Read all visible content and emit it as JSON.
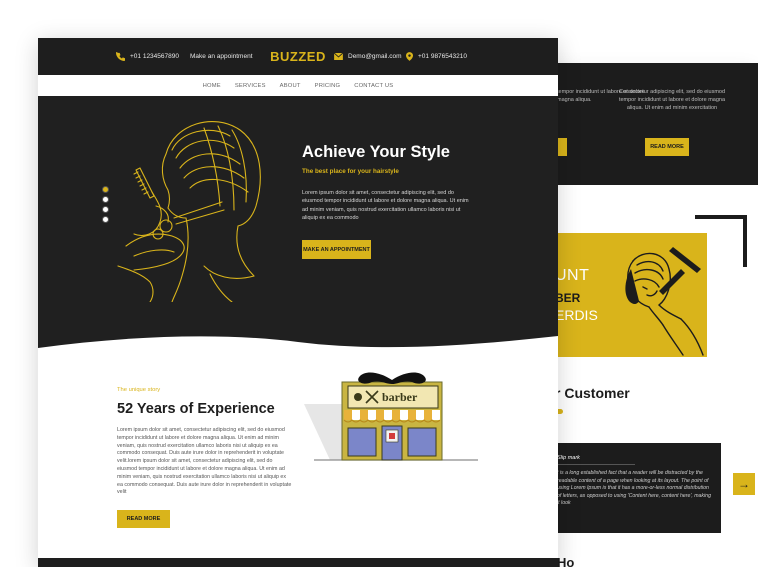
{
  "topbar": {
    "phone_left": "+01 1234567890",
    "appointment": "Make an appointment",
    "brand": "BUZZED",
    "email": "Demo@gmail.com",
    "phone_right": "+01 9876543210"
  },
  "nav": {
    "items": [
      "HOME",
      "SERVICES",
      "ABOUT",
      "PRICING",
      "CONTACT US"
    ]
  },
  "hero": {
    "title": "Achieve Your Style",
    "subtitle": "The best place for your hairstyle",
    "text": "Lorem ipsum dolor sit amet, consectetur adipiscing elit, sed do eiusmod tempor incididunt ut labore et dolore magna aliqua. Ut enim ad minim veniam, quis nostrud exercitation ullamco laboris nisi ut aliquip ex ea commodo",
    "button": "MAKE AN APPOINTMENT",
    "slides": 4,
    "active_slide": 1
  },
  "story": {
    "label": "The unique story",
    "title": "52 Years of Experience",
    "text": "Lorem ipsum dolor sit amet, consectetur adipiscing elit, sed do eiusmod tempor incididunt ut labore et dolore magna aliqua. Ut enim ad minim veniam, quis nostrud exercitation ullamco laboris nisi ut aliquip ex ea commodo consequat. Duis aute irure dolor in reprehenderit in voluptate velit.lorem ipsum dolor sit amet, consectetur adipiscing elit, sed do eiusmod tempor incididunt ut labore et dolore magna aliqua. Ut enim ad minim veniam, quis nostrud exercitation ullamco laboris nisi ut aliquip ex ea commodo consequat. Duis aute irure dolor in reprehenderit in voluptate velit",
    "button": "READ MORE",
    "shop_sign": "barber"
  },
  "background_page": {
    "dark_text_left": "tempor incididunt ut labore et dolore magna aliqua.",
    "dark_text_right": "Consectetur adipiscing elit, sed do eiusmod tempor incididunt ut labore et dolore magna aliqua. Ut enim ad minim exercitation",
    "read_more": "READ MORE",
    "promo_line1": "UNT",
    "promo_line2": "BER",
    "promo_line3": "ERDIS",
    "customer_heading": "r Customer",
    "testimonial_title": "Slip mark",
    "testimonial_text": "t is a long established fact that a reader will be distracted by the readable content of a page when looking at its layout. The point of using Lorem Ipsum is that it has a more-or-less normal distribution of letters, as opposed to using 'Content here, content here', making it look",
    "next_arrow": "→",
    "bottom_heading": "Ho"
  },
  "colors": {
    "accent": "#d9b41b",
    "dark": "#1e1e1e",
    "white": "#ffffff"
  }
}
